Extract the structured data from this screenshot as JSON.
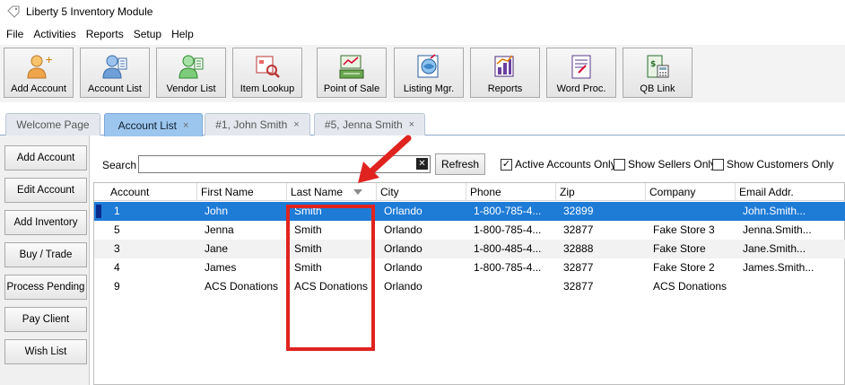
{
  "window": {
    "title": "Liberty 5 Inventory Module"
  },
  "menu": [
    "File",
    "Activities",
    "Reports",
    "Setup",
    "Help"
  ],
  "toolbar": [
    {
      "label": "Add Account",
      "icon": "add-account-icon"
    },
    {
      "label": "Account List",
      "icon": "account-list-icon"
    },
    {
      "label": "Vendor List",
      "icon": "vendor-list-icon"
    },
    {
      "label": "Item Lookup",
      "icon": "item-lookup-icon"
    },
    {
      "label": "Point of Sale",
      "icon": "point-of-sale-icon"
    },
    {
      "label": "Listing Mgr.",
      "icon": "listing-manager-icon"
    },
    {
      "label": "Reports",
      "icon": "reports-icon"
    },
    {
      "label": "Word Proc.",
      "icon": "word-processor-icon"
    },
    {
      "label": "QB Link",
      "icon": "qb-link-icon"
    }
  ],
  "tabs": [
    {
      "label": "Welcome Page",
      "closable": false,
      "active": false
    },
    {
      "label": "Account List",
      "close": "×",
      "active": true
    },
    {
      "label": "#1, John Smith",
      "close": "×",
      "active": false
    },
    {
      "label": "#5, Jenna Smith",
      "close": "×",
      "active": false
    }
  ],
  "sidebar": [
    "Add Account",
    "Edit Account",
    "Add Inventory",
    "Buy / Trade",
    "Process Pending",
    "Pay Client",
    "Wish List"
  ],
  "search": {
    "label": "Search",
    "value": "",
    "refresh_label": "Refresh",
    "clear_glyph": "✕"
  },
  "filters": [
    {
      "label": "Active Accounts Only",
      "checked": true
    },
    {
      "label": "Show Sellers Only",
      "checked": false
    },
    {
      "label": "Show Customers Only",
      "checked": false
    }
  ],
  "table": {
    "columns": [
      "Account",
      "First Name",
      "Last Name",
      "City",
      "Phone",
      "Zip",
      "Company",
      "Email Addr."
    ],
    "sort_column": "Last Name",
    "rows": [
      [
        "1",
        "John",
        "Smith",
        "Orlando",
        "1-800-785-4...",
        "32899",
        "",
        "John.Smith..."
      ],
      [
        "5",
        "Jenna",
        "Smith",
        "Orlando",
        "1-800-785-4...",
        "32877",
        "Fake Store 3",
        "Jenna.Smith..."
      ],
      [
        "3",
        "Jane",
        "Smith",
        "Orlando",
        "1-800-485-4...",
        "32888",
        "Fake Store",
        "Jane.Smith..."
      ],
      [
        "4",
        "James",
        "Smith",
        "Orlando",
        "1-800-785-4...",
        "32877",
        "Fake Store 2",
        "James.Smith..."
      ],
      [
        "9",
        "ACS Donations",
        "ACS Donations",
        "Orlando",
        "",
        "32877",
        "ACS Donations",
        ""
      ]
    ],
    "selected_row": 0
  },
  "colors": {
    "selection": "#1e7bd6",
    "active_tab": "#9cc6ee",
    "annotation": "#e0231f"
  }
}
